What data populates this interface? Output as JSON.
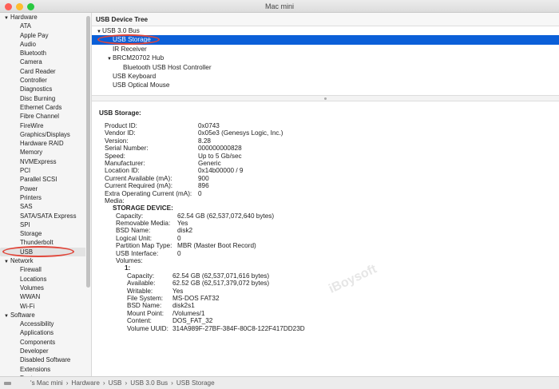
{
  "window": {
    "title": "Mac mini",
    "controls": {
      "close": "#fe5f57",
      "minimize": "#febc2e",
      "zoom": "#28c840"
    }
  },
  "sidebar": {
    "groups": [
      {
        "label": "Hardware",
        "items": [
          "ATA",
          "Apple Pay",
          "Audio",
          "Bluetooth",
          "Camera",
          "Card Reader",
          "Controller",
          "Diagnostics",
          "Disc Burning",
          "Ethernet Cards",
          "Fibre Channel",
          "FireWire",
          "Graphics/Displays",
          "Hardware RAID",
          "Memory",
          "NVMExpress",
          "PCI",
          "Parallel SCSI",
          "Power",
          "Printers",
          "SAS",
          "SATA/SATA Express",
          "SPI",
          "Storage",
          "Thunderbolt",
          "USB"
        ]
      },
      {
        "label": "Network",
        "items": [
          "Firewall",
          "Locations",
          "Volumes",
          "WWAN",
          "Wi-Fi"
        ]
      },
      {
        "label": "Software",
        "items": [
          "Accessibility",
          "Applications",
          "Components",
          "Developer",
          "Disabled Software",
          "Extensions",
          "Fonts"
        ]
      }
    ],
    "selected": "USB"
  },
  "tree": {
    "title": "USB Device Tree",
    "rows": [
      {
        "label": "USB 3.0 Bus",
        "indent": 0,
        "disclosure": true
      },
      {
        "label": "USB Storage",
        "indent": 1,
        "selected": true
      },
      {
        "label": "IR Receiver",
        "indent": 1
      },
      {
        "label": "BRCM20702 Hub",
        "indent": 1,
        "disclosure": true
      },
      {
        "label": "Bluetooth USB Host Controller",
        "indent": 2
      },
      {
        "label": "USB Keyboard",
        "indent": 1
      },
      {
        "label": "USB Optical Mouse",
        "indent": 1
      }
    ]
  },
  "detail": {
    "title": "USB Storage:",
    "fields": [
      [
        "Product ID:",
        "0x0743"
      ],
      [
        "Vendor ID:",
        "0x05e3  (Genesys Logic, Inc.)"
      ],
      [
        "Version:",
        "8.28"
      ],
      [
        "Serial Number:",
        "000000000828"
      ],
      [
        "Speed:",
        "Up to 5 Gb/sec"
      ],
      [
        "Manufacturer:",
        "Generic"
      ],
      [
        "Location ID:",
        "0x14b00000 / 9"
      ],
      [
        "Current Available (mA):",
        "900"
      ],
      [
        "Current Required (mA):",
        "896"
      ],
      [
        "Extra Operating Current (mA):",
        "0"
      ],
      [
        "Media:",
        ""
      ]
    ],
    "storage_heading": "STORAGE DEVICE:",
    "storage": [
      [
        "Capacity:",
        "62.54 GB (62,537,072,640 bytes)"
      ],
      [
        "Removable Media:",
        "Yes"
      ],
      [
        "BSD Name:",
        "disk2"
      ],
      [
        "Logical Unit:",
        "0"
      ],
      [
        "Partition Map Type:",
        "MBR (Master Boot Record)"
      ],
      [
        "USB Interface:",
        "0"
      ],
      [
        "Volumes:",
        ""
      ]
    ],
    "volume_heading": "1:",
    "volume": [
      [
        "Capacity:",
        "62.54 GB (62,537,071,616 bytes)"
      ],
      [
        "Available:",
        "62.52 GB (62,517,379,072 bytes)"
      ],
      [
        "Writable:",
        "Yes"
      ],
      [
        "File System:",
        "MS-DOS FAT32"
      ],
      [
        "BSD Name:",
        "disk2s1"
      ],
      [
        "Mount Point:",
        "/Volumes/1"
      ],
      [
        "Content:",
        "DOS_FAT_32"
      ],
      [
        "Volume UUID:",
        "314A989F-27BF-384F-80C8-122F417DD23D"
      ]
    ]
  },
  "watermark": "iBoysoft",
  "statusbar": {
    "path": [
      "'s Mac mini",
      "Hardware",
      "USB",
      "USB 3.0 Bus",
      "USB Storage"
    ],
    "separator": "›"
  },
  "colors": {
    "selection": "#0b5fd8",
    "annotation": "#e0463a"
  }
}
